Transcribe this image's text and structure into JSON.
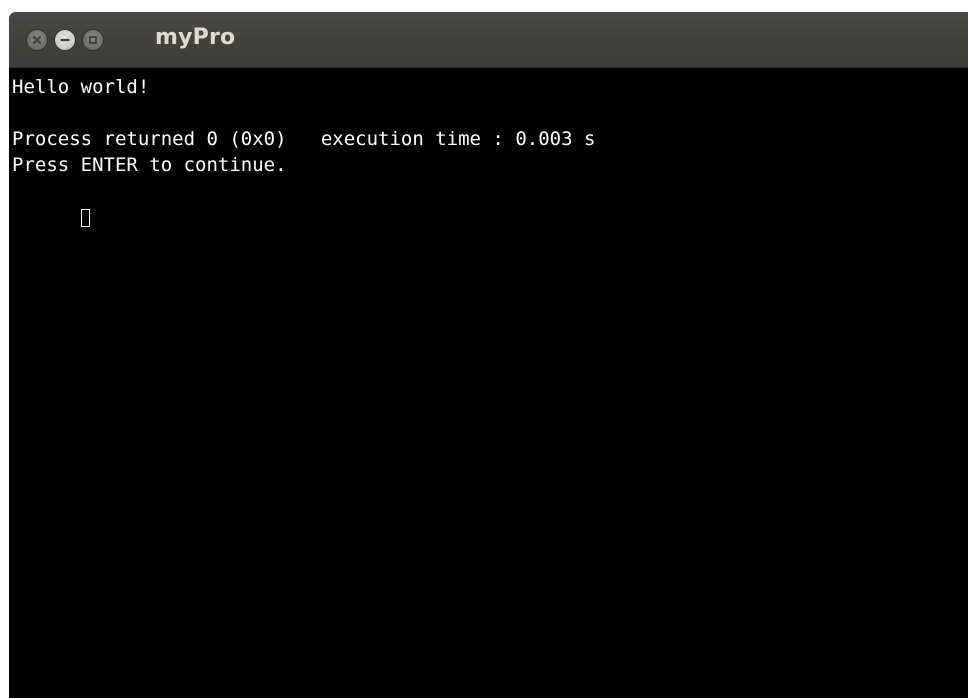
{
  "window": {
    "title": "myPro",
    "buttons": {
      "close_icon": "close-icon",
      "minimize_icon": "minimize-icon",
      "maximize_icon": "maximize-icon"
    }
  },
  "terminal": {
    "lines": [
      "Hello world!",
      "",
      "Process returned 0 (0x0)   execution time : 0.003 s",
      "Press ENTER to continue."
    ],
    "text_color": "#ffffff",
    "background_color": "#000000"
  }
}
